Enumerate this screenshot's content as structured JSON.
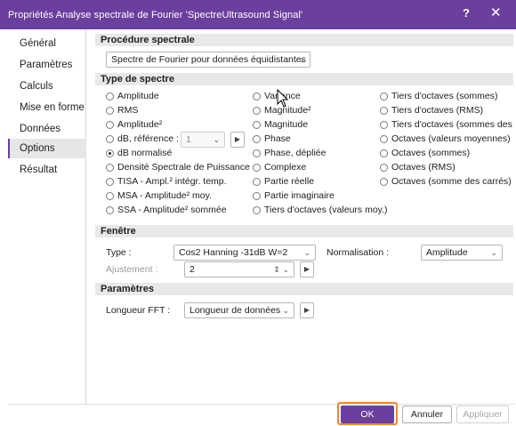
{
  "window": {
    "title": "Propriétés Analyse spectrale de Fourier 'SpectreUltrasound Signal'",
    "help_glyph": "?",
    "close_glyph": "✕"
  },
  "sidebar": {
    "items": [
      {
        "label": "Général"
      },
      {
        "label": "Paramètres"
      },
      {
        "label": "Calculs"
      },
      {
        "label": "Mise en forme"
      },
      {
        "label": "Données"
      },
      {
        "label": "Options",
        "active": true
      },
      {
        "label": "Résultat"
      }
    ]
  },
  "procedure": {
    "header": "Procédure spectrale",
    "selected": "Spectre de Fourier pour données équidistantes"
  },
  "spectrum": {
    "header": "Type de spectre",
    "col1": [
      "Amplitude",
      "RMS",
      "Amplitude²",
      "dB, référence :",
      "dB normalisé",
      "Densité Spectrale de Puissance",
      "TISA - Ampl.² intégr. temp.",
      "MSA - Amplitude² moy.",
      "SSA - Amplitude² sommée"
    ],
    "col2": [
      "Variance",
      "Magnitude²",
      "Magnitude",
      "Phase",
      "Phase, dépliée",
      "Complexe",
      "Partie réelle",
      "Partie imaginaire",
      "Tiers d'octaves (valeurs moy.)"
    ],
    "col3": [
      "Tiers d'octaves (sommes)",
      "Tiers d'octaves (RMS)",
      "Tiers d'octaves (sommes des carrés)",
      "Octaves (valeurs moyennes)",
      "Octaves (sommes)",
      "Octaves (RMS)",
      "Octaves (somme des carrés)"
    ],
    "selected": "dB normalisé",
    "db_reference_value": "1"
  },
  "window_section": {
    "header": "Fenêtre",
    "type_label": "Type :",
    "type_value": "Cos2 Hanning -31dB W=2",
    "normalisation_label": "Normalisation :",
    "normalisation_value": "Amplitude",
    "adjust_label": "Ajustement :",
    "adjust_value": "2"
  },
  "params": {
    "header": "Paramètres",
    "fft_label": "Longueur FFT :",
    "fft_value": "Longueur de données"
  },
  "buttons": {
    "ok": "OK",
    "cancel": "Annuler",
    "apply": "Appliquer"
  },
  "colors": {
    "accent": "#6b3f9e",
    "highlight": "#f08a2c"
  }
}
